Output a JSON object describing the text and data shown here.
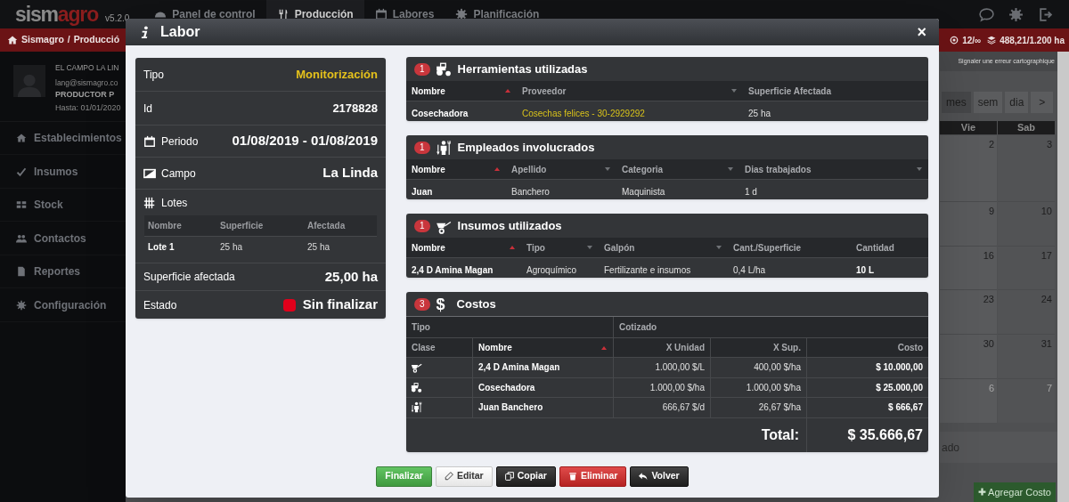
{
  "topbar": {
    "logo": [
      "sism",
      "agro"
    ],
    "version": "v5.2.0",
    "tabs": [
      {
        "label": "Panel de control",
        "selected": false
      },
      {
        "label": "Producción",
        "selected": true
      },
      {
        "label": "Labores",
        "selected": false
      },
      {
        "label": "Planificación",
        "selected": false
      }
    ]
  },
  "breadcrumb": {
    "path": [
      "Sismagro",
      "/",
      "Producció"
    ],
    "counters": [
      "12/∞",
      "488,21/1.200 ha"
    ]
  },
  "sidebar": {
    "user": {
      "name": "EL CAMPO LA LIN",
      "email": "lang@sismagro.co",
      "role": "PRODUCTOR P",
      "expires": "Hasta: 01/01/2020"
    },
    "items": [
      {
        "label": "Establecimientos"
      },
      {
        "label": "Insumos"
      },
      {
        "label": "Stock"
      },
      {
        "label": "Contactos"
      },
      {
        "label": "Reportes"
      },
      {
        "label": "Configuración"
      }
    ]
  },
  "calendar": {
    "map_notice": "Signaler une erreur cartographique",
    "views": [
      {
        "label": "mes",
        "selected": true
      },
      {
        "label": "sem",
        "selected": false
      },
      {
        "label": "dia",
        "selected": false
      }
    ],
    "next": ">",
    "day_headers": [
      "Vie",
      "Sab"
    ],
    "weeks": [
      {
        "days": [
          "2",
          "3"
        ],
        "other_month": false
      },
      {
        "days": [
          "9",
          "10"
        ],
        "other_month": false
      },
      {
        "days": [
          "16",
          "17"
        ],
        "other_month": false
      },
      {
        "days": [
          "23",
          "24"
        ],
        "other_month": false
      },
      {
        "days": [
          "30",
          "31"
        ],
        "other_month": false
      },
      {
        "days": [
          "6",
          "7"
        ],
        "other_month": true
      }
    ],
    "legend": "ado",
    "add_button": "Agregar Costo"
  },
  "modal": {
    "title": "Labor",
    "close": "×",
    "summary": {
      "tipo": {
        "label": "Tipo",
        "value": "Monitorización"
      },
      "id": {
        "label": "Id",
        "value": "2178828"
      },
      "periodo": {
        "label": "Periodo",
        "value": "01/08/2019 - 01/08/2019"
      },
      "campo": {
        "label": "Campo",
        "value": "La Linda"
      },
      "lotes": {
        "label": "Lotes",
        "columns": [
          "Nombre",
          "Superficie",
          "Afectada"
        ],
        "rows": [
          [
            "Lote 1",
            "25 ha",
            "25 ha"
          ]
        ]
      },
      "superficie": {
        "label": "Superficie afectada",
        "value": "25,00 ha"
      },
      "estado": {
        "label": "Estado",
        "value": "Sin finalizar",
        "finished": false
      }
    },
    "panels": [
      {
        "kind": "tools",
        "count": "1",
        "title": "Herramientas utilizadas",
        "columns": [
          {
            "label": "Nombre",
            "sorted": true
          },
          {
            "label": "Proveedor",
            "sorted": false
          },
          {
            "label": "Superficie Afectada"
          }
        ],
        "rows": [
          [
            "Cosechadora",
            "Cosechas felices - 30-2929292",
            "25 ha"
          ]
        ]
      },
      {
        "kind": "employees",
        "count": "1",
        "title": "Empleados involucrados",
        "columns": [
          {
            "label": "Nombre",
            "sorted": true
          },
          {
            "label": "Apellido",
            "sorted": false
          },
          {
            "label": "Categoria",
            "sorted": false
          },
          {
            "label": "Dias trabajados",
            "sorted": false
          }
        ],
        "rows": [
          [
            "Juan",
            "Banchero",
            "Maquinista",
            "1 d"
          ]
        ]
      },
      {
        "kind": "supplies",
        "count": "1",
        "title": "Insumos utilizados",
        "columns": [
          {
            "label": "Nombre",
            "sorted": true
          },
          {
            "label": "Tipo",
            "sorted": false
          },
          {
            "label": "Galpón",
            "sorted": false
          },
          {
            "label": "Cant./Superficie"
          },
          {
            "label": "Cantidad"
          }
        ],
        "rows": [
          [
            "2,4 D Amina Magan",
            "Agroquímico",
            "Fertilizante e insumos",
            "0,4 L/ha",
            "10 L"
          ]
        ]
      }
    ],
    "costs": {
      "count": "3",
      "icon": "$",
      "title": "Costos",
      "groups": [
        "Tipo",
        "Cotizado"
      ],
      "columns": [
        {
          "label": "Clase"
        },
        {
          "label": "Nombre",
          "sorted": true
        },
        {
          "label": "X Unidad"
        },
        {
          "label": "X Sup."
        },
        {
          "label": "Costo"
        }
      ],
      "rows": [
        {
          "kind": "supply",
          "cells": [
            "",
            "2,4 D Amina Magan",
            "1.000,00 $/L",
            "400,00 $/ha",
            "$ 10.000,00"
          ]
        },
        {
          "kind": "tool",
          "cells": [
            "",
            "Cosechadora",
            "1.000,00 $/ha",
            "1.000,00 $/ha",
            "$ 25.000,00"
          ]
        },
        {
          "kind": "employee",
          "cells": [
            "",
            "Juan Banchero",
            "666,67 $/d",
            "26,67 $/ha",
            "$ 666,67"
          ]
        }
      ],
      "total": {
        "label": "Total:",
        "value": "$ 35.666,67"
      }
    },
    "buttons": [
      {
        "label": "Finalizar",
        "kind": "success"
      },
      {
        "label": "Editar",
        "kind": "default"
      },
      {
        "label": "Copiar",
        "kind": "dark"
      },
      {
        "label": "Eliminar",
        "kind": "danger"
      },
      {
        "label": "Volver",
        "kind": "dark"
      }
    ]
  }
}
